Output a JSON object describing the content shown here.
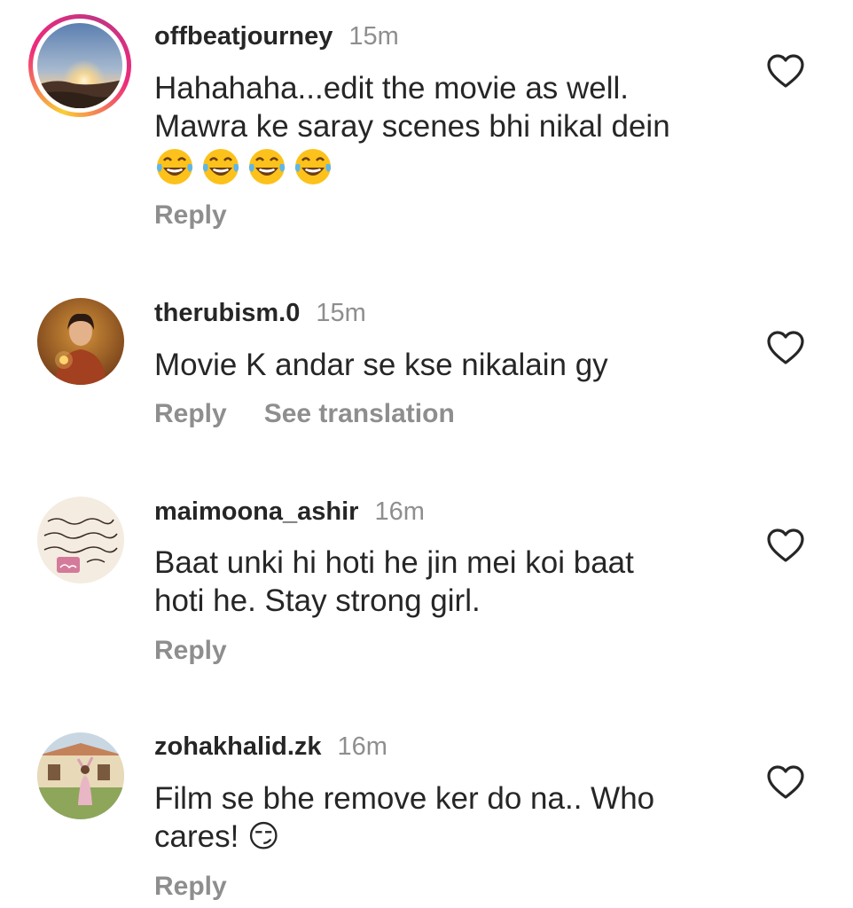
{
  "comments": [
    {
      "username": "offbeatjourney",
      "time": "15m",
      "lines": [
        "Hahahaha...edit the movie as well.",
        "Mawra ke saray scenes bhi nikal dein"
      ],
      "emoji_line": "😂😂😂😂",
      "reply": "Reply",
      "like_icon": "heart-outline"
    },
    {
      "username": "therubism.0",
      "time": "15m",
      "lines": [
        "Movie K andar se kse nikalain gy"
      ],
      "reply": "Reply",
      "translate": "See translation",
      "like_icon": "heart-outline"
    },
    {
      "username": "maimoona_ashir",
      "time": "16m",
      "lines": [
        "Baat unki hi hoti he jin mei koi baat",
        "hoti he. Stay strong girl."
      ],
      "reply": "Reply",
      "like_icon": "heart-outline"
    },
    {
      "username": "zohakhalid.zk",
      "time": "16m",
      "lines": [
        "Film se bhe remove ker do na.. Who",
        "cares! 😏"
      ],
      "reply": "Reply",
      "like_icon": "heart-outline"
    }
  ],
  "colors": {
    "text": "#262626",
    "secondary": "#8e8e8e",
    "story_ring_start": "#f9ce34",
    "story_ring_end": "#ee2a7b"
  }
}
